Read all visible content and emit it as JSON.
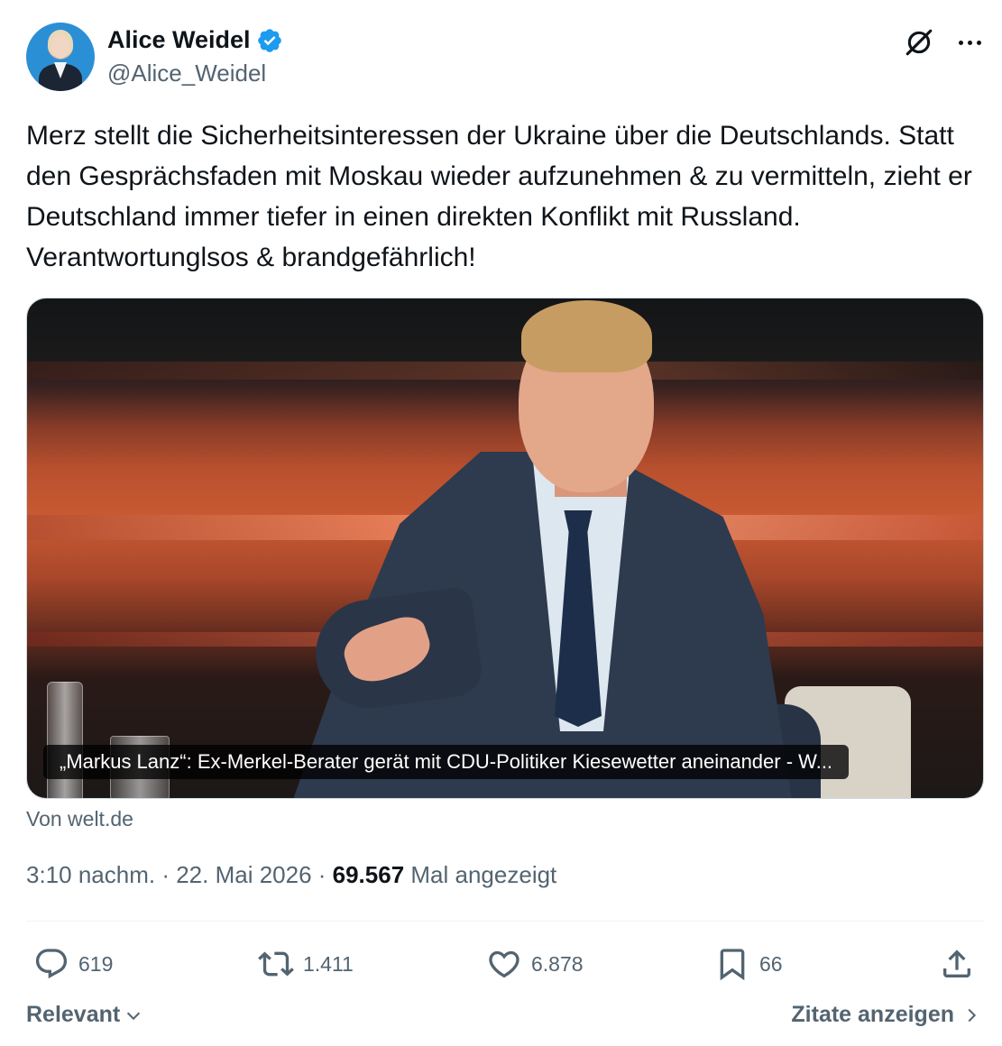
{
  "author": {
    "display_name": "Alice Weidel",
    "handle": "@Alice_Weidel",
    "verified": true,
    "verified_color": "#1d9bf0"
  },
  "icons": {
    "grok": "grok-icon",
    "more": "more-icon",
    "reply": "reply-icon",
    "retweet": "retweet-icon",
    "like": "like-icon",
    "bookmark": "bookmark-icon",
    "share": "share-icon"
  },
  "tweet": {
    "text": "Merz stellt die Sicherheitsinteressen der Ukraine über die Deutschlands. Statt den Gesprächsfaden mit Moskau wieder aufzunehmen & zu vermitteln, zieht er Deutschland immer tiefer in einen direkten Konflikt mit Russland. Verantwortunglsos & brandgefährlich!"
  },
  "link_card": {
    "caption": "„Markus Lanz“: Ex-Merkel-Berater gerät mit CDU-Politiker Kiesewetter aneinander - W...",
    "source": "Von welt.de"
  },
  "meta": {
    "time": "3:10 nachm.",
    "separator": " · ",
    "date": "22. Mai 2026",
    "views_count": "69.567",
    "views_label": " Mal angezeigt"
  },
  "actions": {
    "replies": "619",
    "retweets": "1.411",
    "likes": "6.878",
    "bookmarks": "66"
  },
  "footer": {
    "sort_label": "Relevant",
    "quotes_label": "Zitate anzeigen"
  }
}
